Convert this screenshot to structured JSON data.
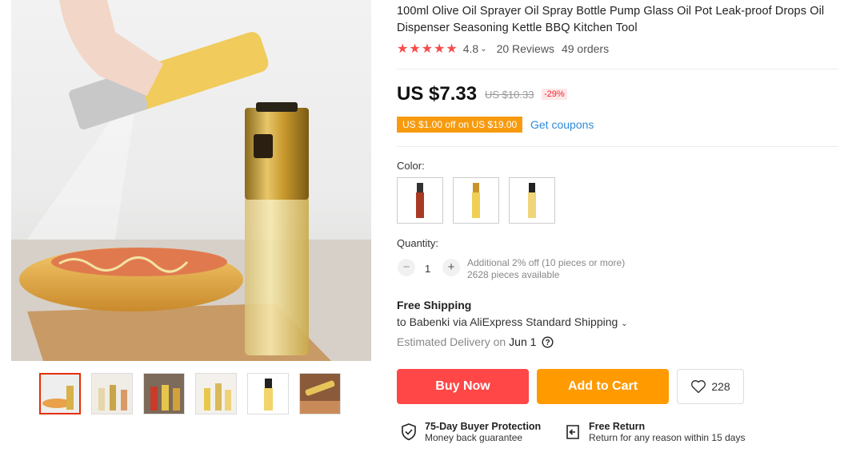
{
  "product": {
    "title": "100ml Olive Oil Sprayer Oil Spray Bottle Pump Glass Oil Pot Leak-proof Drops Oil Dispenser Seasoning Kettle BBQ Kitchen Tool",
    "rating": "4.8",
    "rating_stars": 5,
    "reviews": "20 Reviews",
    "orders": "49 orders"
  },
  "price": {
    "current": "US $7.33",
    "original": "US $10.33",
    "discount": "-29%"
  },
  "coupon": {
    "badge": "US $1.00 off on US $19.00",
    "link": "Get coupons"
  },
  "color": {
    "label": "Color:"
  },
  "quantity": {
    "label": "Quantity:",
    "minus": "−",
    "plus": "+",
    "value": "1",
    "discount_note": "Additional 2% off (10 pieces or more)",
    "available": "2628 pieces available"
  },
  "shipping": {
    "title": "Free Shipping",
    "to_prefix": "to",
    "destination": "Babenki",
    "via": "via AliExpress Standard Shipping",
    "est_label": "Estimated Delivery on",
    "est_date": "Jun 1"
  },
  "actions": {
    "buy_now": "Buy Now",
    "add_to_cart": "Add to Cart",
    "wishlist_count": "228"
  },
  "guarantees": {
    "protection_title": "75-Day Buyer Protection",
    "protection_sub": "Money back guarantee",
    "return_title": "Free Return",
    "return_sub": "Return for any reason within 15 days"
  },
  "colors": {
    "accent_red": "#ff4747",
    "accent_orange": "#ff9a00",
    "link_blue": "#2e8bd8",
    "star_red": "#f74c4c"
  }
}
